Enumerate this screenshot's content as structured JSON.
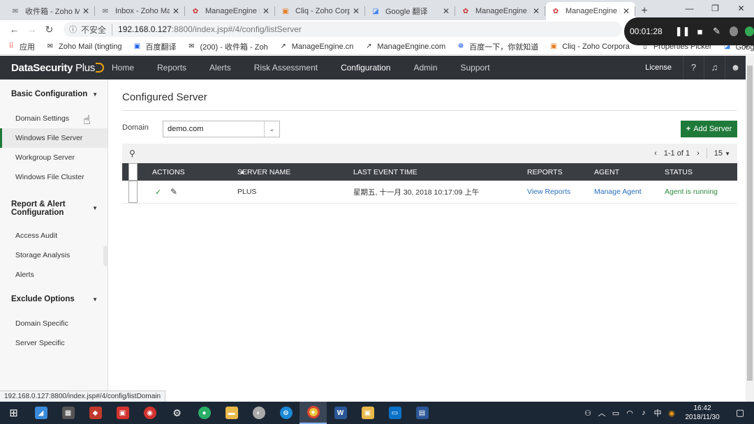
{
  "browser": {
    "tabs": [
      {
        "title": "收件箱 - Zoho M",
        "icon": "mail-icon"
      },
      {
        "title": "Inbox - Zoho Ma",
        "icon": "mail-icon"
      },
      {
        "title": "ManageEngine D",
        "icon": "manageengine-icon"
      },
      {
        "title": "Cliq - Zoho Corp",
        "icon": "cliq-icon"
      },
      {
        "title": "Google 翻译",
        "icon": "google-translate-icon"
      },
      {
        "title": "ManageEngine D",
        "icon": "manageengine-icon"
      },
      {
        "title": "ManageEngine D",
        "icon": "manageengine-icon",
        "active": true
      }
    ],
    "security": "不安全",
    "url_host": "192.168.0.127",
    "url_path": ":8800/index.jsp#/4/config/listServer",
    "bookmarks": [
      "应用",
      "Zoho Mail (tingting",
      "百度翻译",
      "(200) - 收件箱 - Zoh",
      "ManageEngine.cn",
      "ManageEngine.com",
      "百度一下，你就知道",
      "Cliq - Zoho Corpora",
      "Properties Picker",
      "Google 翻译"
    ],
    "recorder_time": "00:01:28",
    "status_url": "192.168.0.127:8800/index.jsp#/4/config/listDomain"
  },
  "app": {
    "logo_main": "DataSecurity",
    "logo_plus": "Plus",
    "nav": [
      "Home",
      "Reports",
      "Alerts",
      "Risk Assessment",
      "Configuration",
      "Admin",
      "Support"
    ],
    "active_nav": "Configuration",
    "license": "License"
  },
  "sidebar": {
    "sections": [
      {
        "title": "Basic Configuration",
        "items": [
          "Domain Settings",
          "Windows File Server",
          "Workgroup Server",
          "Windows File Cluster"
        ]
      },
      {
        "title": "Report & Alert Configuration",
        "items": [
          "Access Audit",
          "Storage Analysis",
          "Alerts"
        ]
      },
      {
        "title": "Exclude Options",
        "items": [
          "Domain Specific",
          "Server Specific"
        ]
      }
    ],
    "active_item": "Windows File Server"
  },
  "main": {
    "title": "Configured Server",
    "domain_label": "Domain",
    "domain_value": "demo.com",
    "add_button": "Add Server",
    "pager": "1-1 of 1",
    "page_size": "15",
    "columns": [
      "ACTIONS",
      "SERVER NAME",
      "LAST EVENT TIME",
      "REPORTS",
      "AGENT",
      "STATUS"
    ],
    "rows": [
      {
        "server_name": "PLUS",
        "last_event_time": "星期五, 十一月 30, 2018 10:17:09 上午",
        "reports": "View Reports",
        "agent": "Manage Agent",
        "status": "Agent is running"
      }
    ]
  },
  "taskbar": {
    "ime": "中",
    "time": "16:42",
    "date": "2018/11/30"
  },
  "colors": {
    "header_bg": "#2f3237",
    "accent_green": "#1f7a3a",
    "link_blue": "#2a6ebb",
    "status_green": "#2e8b3f"
  }
}
